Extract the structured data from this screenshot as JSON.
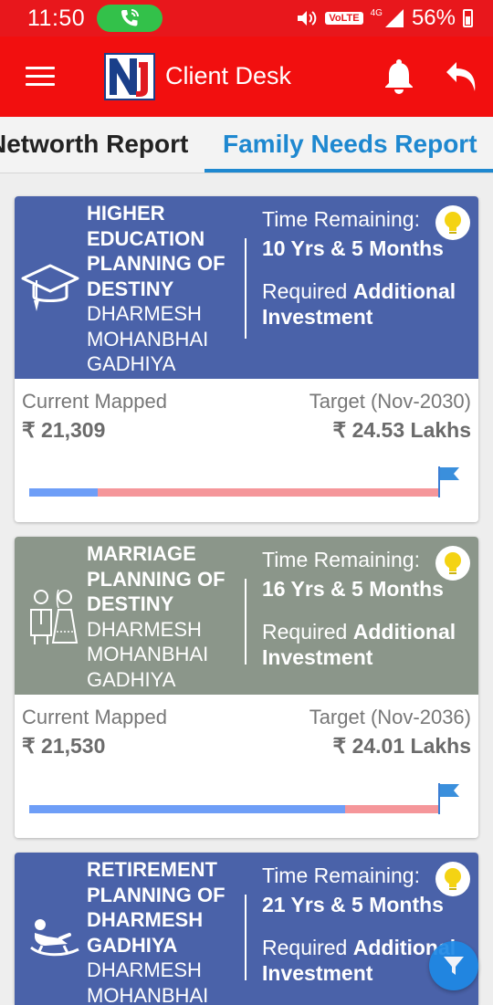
{
  "status_bar": {
    "time": "11:50",
    "network_type": "4G",
    "volte": "VoLTE",
    "battery": "56%"
  },
  "app_bar": {
    "title": "Client Desk",
    "logo_text": "Nj"
  },
  "tabs": [
    {
      "label": "Networth Report",
      "selected": false
    },
    {
      "label": "Family Needs Report",
      "selected": true
    }
  ],
  "goals": [
    {
      "title": "HIGHER EDUCATION PLANNING OF DESTINY",
      "person": "DHARMESH MOHANBHAI GADHIYA",
      "icon": "graduation-cap-icon",
      "color": "#4a62a9",
      "time_label": "Time Remaining:",
      "time_value": "10 Yrs & 5 Months",
      "required_prefix": "Required ",
      "required_bold": "Additional Investment",
      "current_label": "Current Mapped",
      "current_value": "₹ 21,309",
      "target_label": "Target (Nov-2030)",
      "target_value": "₹ 24.53 Lakhs",
      "progress": 0.168
    },
    {
      "title": "MARRIAGE PLANNING OF DESTINY",
      "person": "DHARMESH MOHANBHAI GADHIYA",
      "icon": "wedding-couple-icon",
      "color": "#8b968a",
      "time_label": "Time Remaining:",
      "time_value": "16 Yrs & 5 Months",
      "required_prefix": "Required ",
      "required_bold": "Additional Investment",
      "current_label": "Current Mapped",
      "current_value": "₹ 21,530",
      "target_label": "Target (Nov-2036)",
      "target_value": "₹ 24.01 Lakhs",
      "progress": 0.772
    },
    {
      "title": "RETIREMENT PLANNING OF DHARMESH GADHIYA",
      "person": "DHARMESH MOHANBHAI",
      "icon": "rocking-chair-icon",
      "color": "#4a62a9",
      "time_label": "Time Remaining:",
      "time_value": "21 Yrs & 5 Months",
      "required_prefix": "Required ",
      "required_bold": "Additional Investment"
    }
  ],
  "colors": {
    "app_bar": "#f20f0f",
    "tab_active": "#1e88d0",
    "progress_fill": "#6e9ef7",
    "progress_track": "#f5969a",
    "fab": "#1e88e5"
  }
}
